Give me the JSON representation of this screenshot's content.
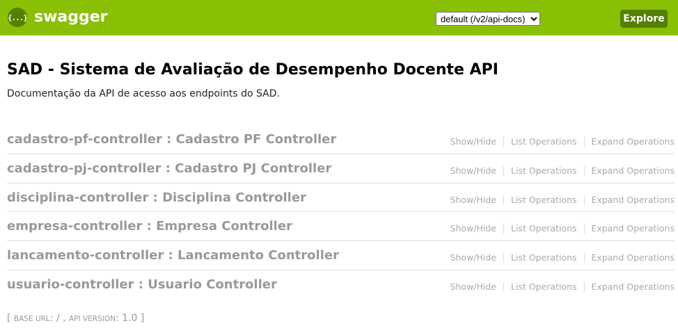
{
  "header": {
    "logo_glyph": "{...}",
    "logo_text": "swagger",
    "spec_select_value": "default (/v2/api-docs)",
    "explore_label": "Explore",
    "brand_color": "#89bf04",
    "accent_color": "#547f00"
  },
  "info": {
    "title": "SAD - Sistema de Avaliação de Desempenho Docente API",
    "description": "Documentação da API de acesso aos endpoints do SAD."
  },
  "resources": [
    {
      "name": "cadastro-pf-controller : Cadastro PF Controller",
      "show_hide": "Show/Hide",
      "list_ops": "List Operations",
      "expand_ops": "Expand Operations"
    },
    {
      "name": "cadastro-pj-controller : Cadastro PJ Controller",
      "show_hide": "Show/Hide",
      "list_ops": "List Operations",
      "expand_ops": "Expand Operations"
    },
    {
      "name": "disciplina-controller : Disciplina Controller",
      "show_hide": "Show/Hide",
      "list_ops": "List Operations",
      "expand_ops": "Expand Operations"
    },
    {
      "name": "empresa-controller : Empresa Controller",
      "show_hide": "Show/Hide",
      "list_ops": "List Operations",
      "expand_ops": "Expand Operations"
    },
    {
      "name": "lancamento-controller : Lancamento Controller",
      "show_hide": "Show/Hide",
      "list_ops": "List Operations",
      "expand_ops": "Expand Operations"
    },
    {
      "name": "usuario-controller : Usuario Controller",
      "show_hide": "Show/Hide",
      "list_ops": "List Operations",
      "expand_ops": "Expand Operations"
    }
  ],
  "footer": {
    "open_bracket": "[",
    "base_url_label": "base url",
    "base_url_value": ": / ,",
    "api_version_label": "api version",
    "api_version_value": ": 1.0",
    "close_bracket": "]"
  }
}
